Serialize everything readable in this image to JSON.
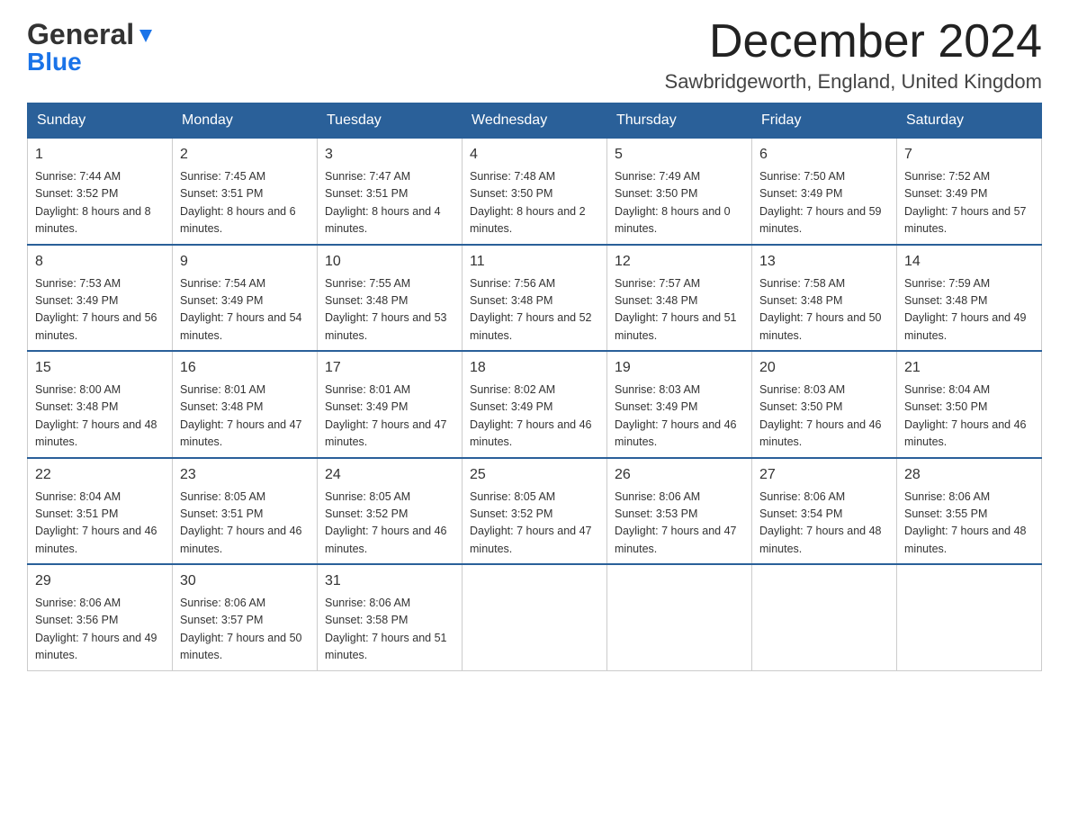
{
  "header": {
    "logo_line1": "General",
    "logo_line2": "Blue",
    "month_title": "December 2024",
    "location": "Sawbridgeworth, England, United Kingdom"
  },
  "weekdays": [
    "Sunday",
    "Monday",
    "Tuesday",
    "Wednesday",
    "Thursday",
    "Friday",
    "Saturday"
  ],
  "weeks": [
    [
      {
        "day": "1",
        "sunrise": "7:44 AM",
        "sunset": "3:52 PM",
        "daylight": "8 hours and 8 minutes."
      },
      {
        "day": "2",
        "sunrise": "7:45 AM",
        "sunset": "3:51 PM",
        "daylight": "8 hours and 6 minutes."
      },
      {
        "day": "3",
        "sunrise": "7:47 AM",
        "sunset": "3:51 PM",
        "daylight": "8 hours and 4 minutes."
      },
      {
        "day": "4",
        "sunrise": "7:48 AM",
        "sunset": "3:50 PM",
        "daylight": "8 hours and 2 minutes."
      },
      {
        "day": "5",
        "sunrise": "7:49 AM",
        "sunset": "3:50 PM",
        "daylight": "8 hours and 0 minutes."
      },
      {
        "day": "6",
        "sunrise": "7:50 AM",
        "sunset": "3:49 PM",
        "daylight": "7 hours and 59 minutes."
      },
      {
        "day": "7",
        "sunrise": "7:52 AM",
        "sunset": "3:49 PM",
        "daylight": "7 hours and 57 minutes."
      }
    ],
    [
      {
        "day": "8",
        "sunrise": "7:53 AM",
        "sunset": "3:49 PM",
        "daylight": "7 hours and 56 minutes."
      },
      {
        "day": "9",
        "sunrise": "7:54 AM",
        "sunset": "3:49 PM",
        "daylight": "7 hours and 54 minutes."
      },
      {
        "day": "10",
        "sunrise": "7:55 AM",
        "sunset": "3:48 PM",
        "daylight": "7 hours and 53 minutes."
      },
      {
        "day": "11",
        "sunrise": "7:56 AM",
        "sunset": "3:48 PM",
        "daylight": "7 hours and 52 minutes."
      },
      {
        "day": "12",
        "sunrise": "7:57 AM",
        "sunset": "3:48 PM",
        "daylight": "7 hours and 51 minutes."
      },
      {
        "day": "13",
        "sunrise": "7:58 AM",
        "sunset": "3:48 PM",
        "daylight": "7 hours and 50 minutes."
      },
      {
        "day": "14",
        "sunrise": "7:59 AM",
        "sunset": "3:48 PM",
        "daylight": "7 hours and 49 minutes."
      }
    ],
    [
      {
        "day": "15",
        "sunrise": "8:00 AM",
        "sunset": "3:48 PM",
        "daylight": "7 hours and 48 minutes."
      },
      {
        "day": "16",
        "sunrise": "8:01 AM",
        "sunset": "3:48 PM",
        "daylight": "7 hours and 47 minutes."
      },
      {
        "day": "17",
        "sunrise": "8:01 AM",
        "sunset": "3:49 PM",
        "daylight": "7 hours and 47 minutes."
      },
      {
        "day": "18",
        "sunrise": "8:02 AM",
        "sunset": "3:49 PM",
        "daylight": "7 hours and 46 minutes."
      },
      {
        "day": "19",
        "sunrise": "8:03 AM",
        "sunset": "3:49 PM",
        "daylight": "7 hours and 46 minutes."
      },
      {
        "day": "20",
        "sunrise": "8:03 AM",
        "sunset": "3:50 PM",
        "daylight": "7 hours and 46 minutes."
      },
      {
        "day": "21",
        "sunrise": "8:04 AM",
        "sunset": "3:50 PM",
        "daylight": "7 hours and 46 minutes."
      }
    ],
    [
      {
        "day": "22",
        "sunrise": "8:04 AM",
        "sunset": "3:51 PM",
        "daylight": "7 hours and 46 minutes."
      },
      {
        "day": "23",
        "sunrise": "8:05 AM",
        "sunset": "3:51 PM",
        "daylight": "7 hours and 46 minutes."
      },
      {
        "day": "24",
        "sunrise": "8:05 AM",
        "sunset": "3:52 PM",
        "daylight": "7 hours and 46 minutes."
      },
      {
        "day": "25",
        "sunrise": "8:05 AM",
        "sunset": "3:52 PM",
        "daylight": "7 hours and 47 minutes."
      },
      {
        "day": "26",
        "sunrise": "8:06 AM",
        "sunset": "3:53 PM",
        "daylight": "7 hours and 47 minutes."
      },
      {
        "day": "27",
        "sunrise": "8:06 AM",
        "sunset": "3:54 PM",
        "daylight": "7 hours and 48 minutes."
      },
      {
        "day": "28",
        "sunrise": "8:06 AM",
        "sunset": "3:55 PM",
        "daylight": "7 hours and 48 minutes."
      }
    ],
    [
      {
        "day": "29",
        "sunrise": "8:06 AM",
        "sunset": "3:56 PM",
        "daylight": "7 hours and 49 minutes."
      },
      {
        "day": "30",
        "sunrise": "8:06 AM",
        "sunset": "3:57 PM",
        "daylight": "7 hours and 50 minutes."
      },
      {
        "day": "31",
        "sunrise": "8:06 AM",
        "sunset": "3:58 PM",
        "daylight": "7 hours and 51 minutes."
      },
      null,
      null,
      null,
      null
    ]
  ]
}
